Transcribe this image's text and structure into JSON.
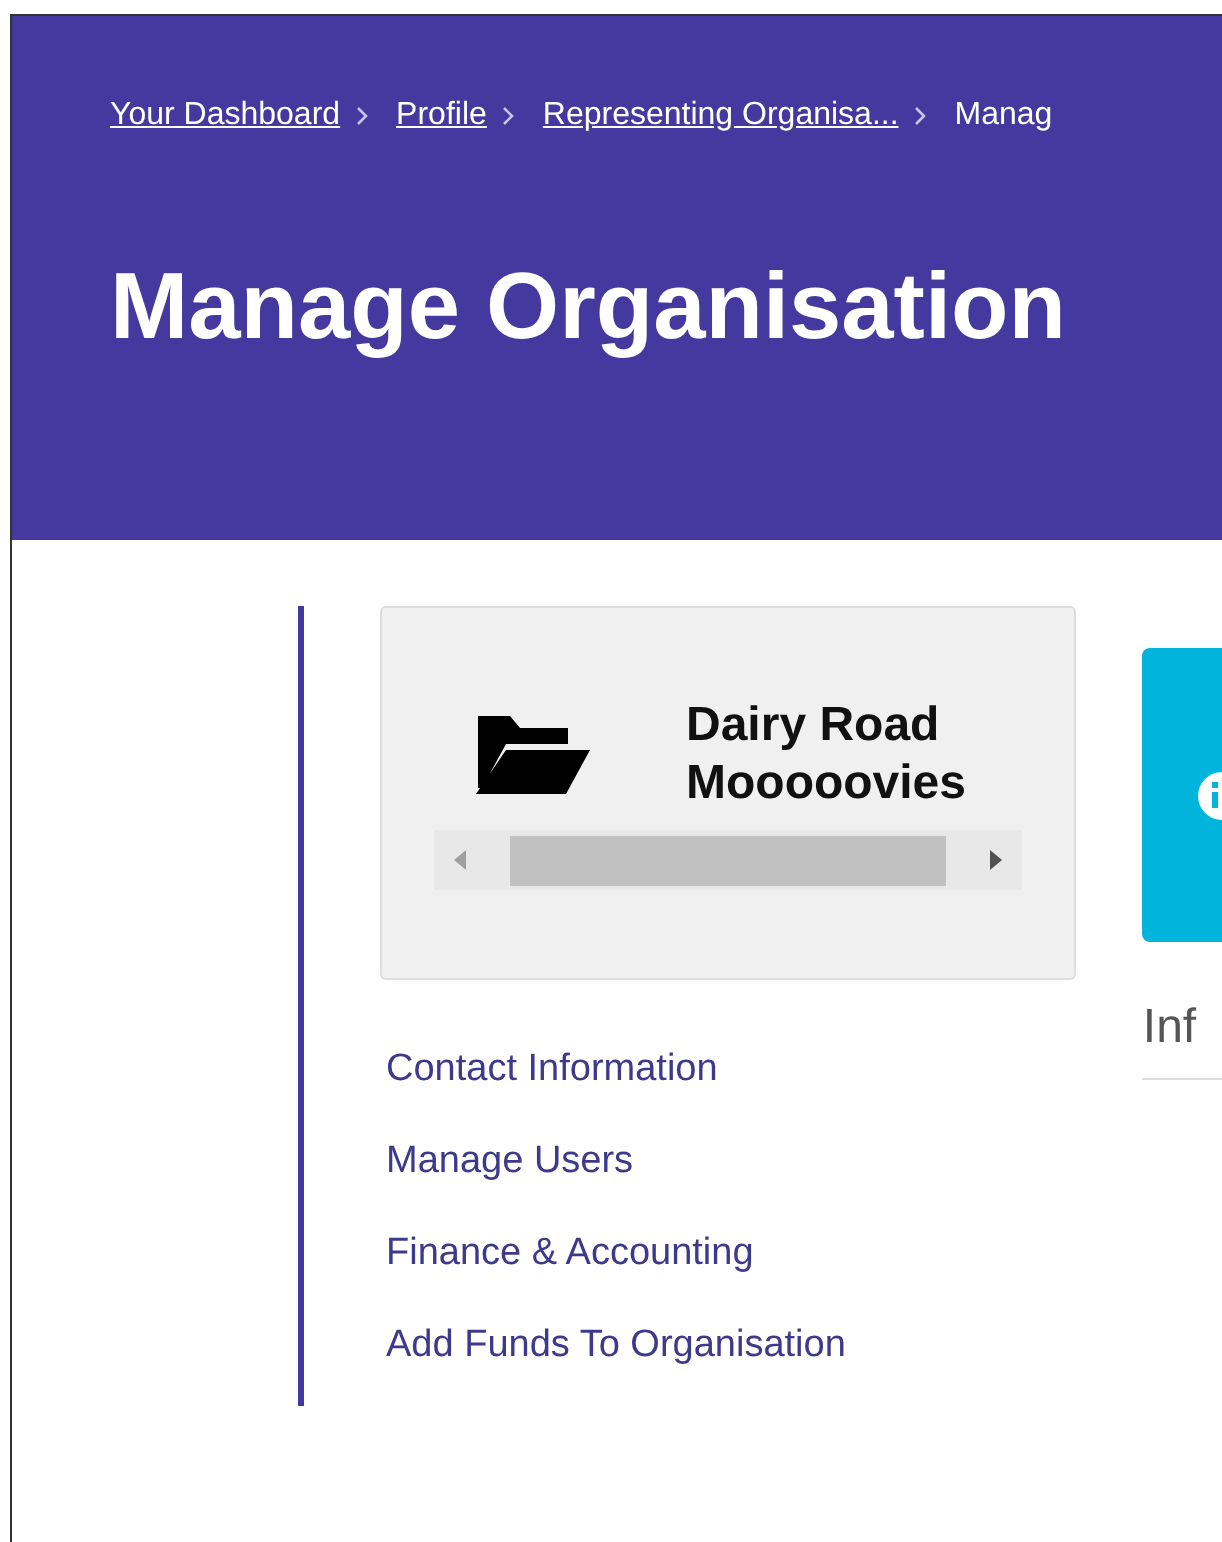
{
  "breadcrumbs": [
    {
      "label": "Your Dashboard",
      "kind": "link"
    },
    {
      "label": "Profile",
      "kind": "link"
    },
    {
      "label": "Representing Organisa...",
      "kind": "link"
    },
    {
      "label": "Manag",
      "kind": "current"
    }
  ],
  "page_title": "Manage Organisation",
  "organisation": {
    "name_lines": [
      "Dairy Road",
      "Mooooovies"
    ]
  },
  "sidebar": {
    "items": [
      {
        "label": "Contact Information"
      },
      {
        "label": "Manage Users"
      },
      {
        "label": "Finance & Accounting"
      },
      {
        "label": "Add Funds To Organisation"
      }
    ]
  },
  "info_panel": {
    "heading": "Inf"
  }
}
